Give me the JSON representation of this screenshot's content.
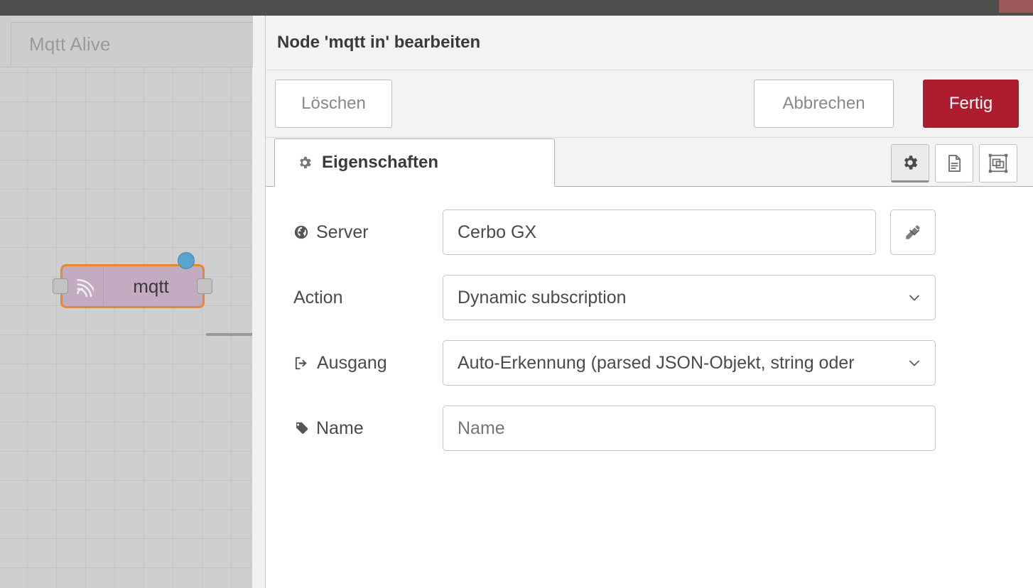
{
  "window": {
    "accent_red": "#9b595c",
    "chrome_bg": "#4e4e4e"
  },
  "editor": {
    "tab_label": "Mqtt Alive",
    "node": {
      "label": "mqtt",
      "body_color": "#c3abc2",
      "selection_color": "#e8892f",
      "status_color": "#5ba3cf",
      "icon": "mqtt-signal-icon"
    }
  },
  "dialog": {
    "title": "Node 'mqtt in' bearbeiten",
    "buttons": {
      "delete": "Löschen",
      "cancel": "Abbrechen",
      "done": "Fertig",
      "done_color": "#ad1d2d"
    },
    "tabs": [
      {
        "label": "Eigenschaften",
        "icon": "gear-icon",
        "active": true
      }
    ],
    "icon_buttons": [
      {
        "name": "properties-gear-icon",
        "active": true
      },
      {
        "name": "description-document-icon",
        "active": false
      },
      {
        "name": "appearance-shape-icon",
        "active": false
      }
    ],
    "form": {
      "server": {
        "label": "Server",
        "icon": "globe-icon",
        "value": "Cerbo GX",
        "edit_button": "pencil-icon"
      },
      "action": {
        "label": "Action",
        "value": "Dynamic subscription"
      },
      "output": {
        "label": "Ausgang",
        "icon": "sign-out-icon",
        "value": "Auto-Erkennung (parsed JSON-Objekt, string oder"
      },
      "name": {
        "label": "Name",
        "icon": "tag-icon",
        "value": "",
        "placeholder": "Name"
      }
    }
  }
}
